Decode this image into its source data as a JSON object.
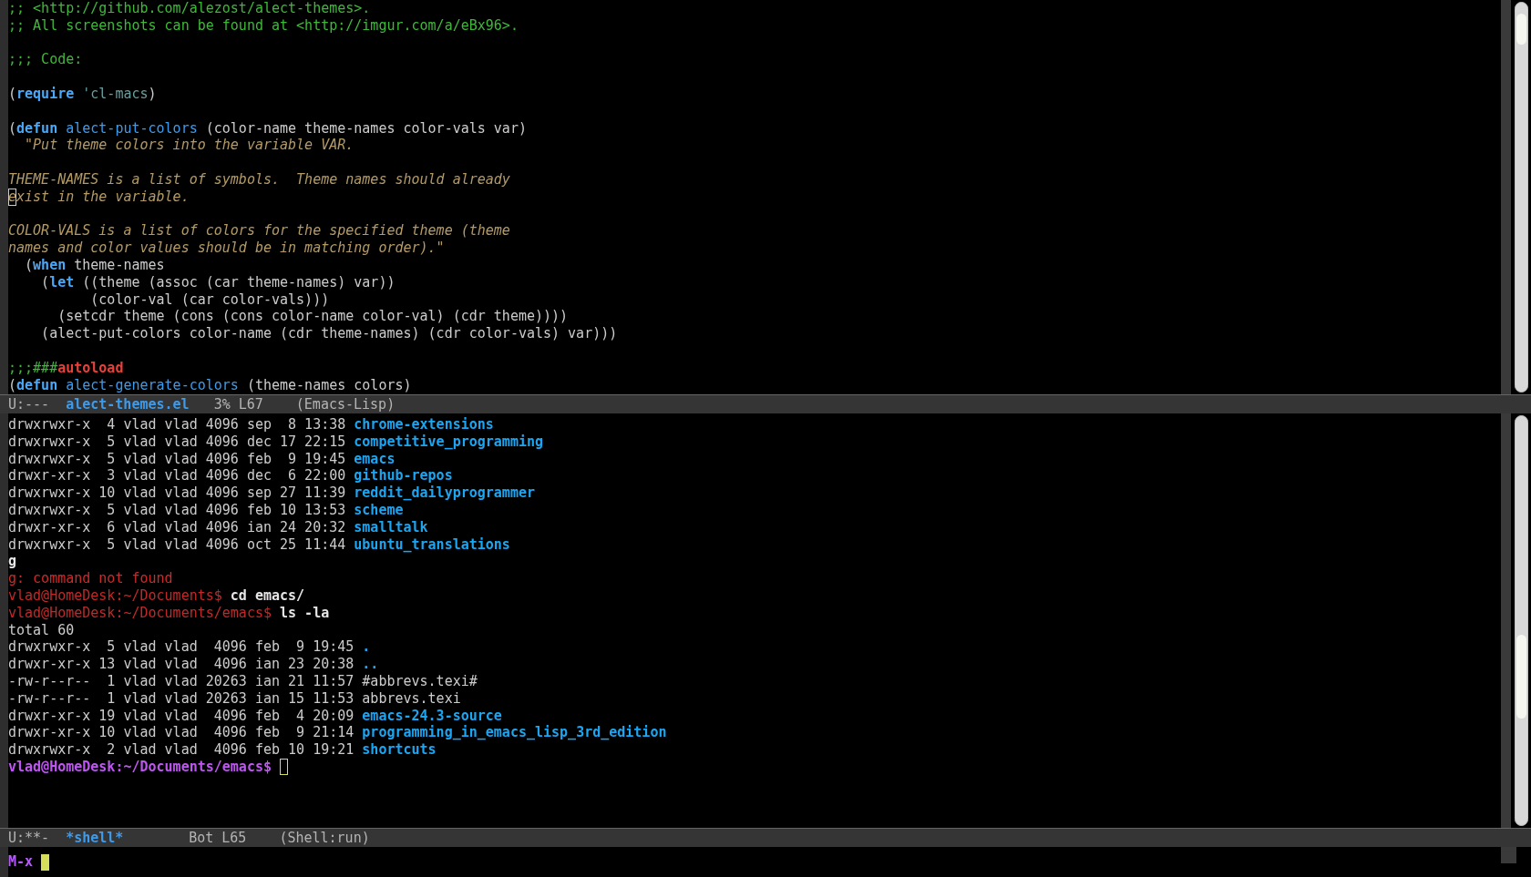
{
  "code_window": {
    "lines": [
      {
        "segments": [
          {
            "kind": "comment",
            "text": ";; <http://github.com/alezost/alect-themes>."
          }
        ]
      },
      {
        "segments": [
          {
            "kind": "comment",
            "text": ";; All screenshots can be found at <http://imgur.com/a/eBx96>."
          }
        ]
      },
      {
        "kind": "blank"
      },
      {
        "segments": [
          {
            "kind": "comment",
            "text": ";;; Code:"
          }
        ]
      },
      {
        "kind": "blank"
      },
      {
        "segments": [
          {
            "kind": "plain",
            "text": "("
          },
          {
            "kind": "keyword",
            "text": "require "
          },
          {
            "kind": "constant",
            "text": "'cl-macs"
          },
          {
            "kind": "plain",
            "text": ")"
          }
        ]
      },
      {
        "kind": "blank"
      },
      {
        "segments": [
          {
            "kind": "plain",
            "text": "("
          },
          {
            "kind": "keyword",
            "text": "defun "
          },
          {
            "kind": "function",
            "text": "alect-put-colors"
          },
          {
            "kind": "plain",
            "text": " (color-name theme-names color-vals var)"
          }
        ]
      },
      {
        "segments": [
          {
            "kind": "doc",
            "text": "  \"Put theme colors into the variable VAR."
          }
        ]
      },
      {
        "kind": "blank"
      },
      {
        "segments": [
          {
            "kind": "doc",
            "text": "THEME-NAMES is a list of symbols.  Theme names should already"
          }
        ]
      },
      {
        "segments": [
          {
            "kind": "cursor",
            "text": "e"
          },
          {
            "kind": "doc",
            "text": "xist in the variable."
          }
        ]
      },
      {
        "kind": "blank"
      },
      {
        "segments": [
          {
            "kind": "doc",
            "text": "COLOR-VALS is a list of colors for the specified theme (theme"
          }
        ]
      },
      {
        "segments": [
          {
            "kind": "doc",
            "text": "names and color values should be in matching order).\""
          }
        ]
      },
      {
        "segments": [
          {
            "kind": "plain",
            "text": "  ("
          },
          {
            "kind": "keyword",
            "text": "when"
          },
          {
            "kind": "plain",
            "text": " theme-names"
          }
        ]
      },
      {
        "segments": [
          {
            "kind": "plain",
            "text": "    ("
          },
          {
            "kind": "keyword",
            "text": "let"
          },
          {
            "kind": "plain",
            "text": " ((theme (assoc (car theme-names) var))"
          }
        ]
      },
      {
        "segments": [
          {
            "kind": "plain",
            "text": "          (color-val (car color-vals)))"
          }
        ]
      },
      {
        "segments": [
          {
            "kind": "plain",
            "text": "      (setcdr theme (cons (cons color-name color-val) (cdr theme))))"
          }
        ]
      },
      {
        "segments": [
          {
            "kind": "plain",
            "text": "    (alect-put-colors color-name (cdr theme-names) (cdr color-vals) var)))"
          }
        ]
      },
      {
        "kind": "blank"
      },
      {
        "segments": [
          {
            "kind": "comment",
            "text": ";;;###"
          },
          {
            "kind": "autoload",
            "text": "autoload"
          }
        ]
      },
      {
        "segments": [
          {
            "kind": "plain",
            "text": "("
          },
          {
            "kind": "keyword",
            "text": "defun "
          },
          {
            "kind": "function",
            "text": "alect-generate-colors"
          },
          {
            "kind": "plain",
            "text": " (theme-names colors)"
          }
        ]
      }
    ],
    "mode_line": {
      "state": "U:---",
      "buffer": "alect-themes.el",
      "position": "3% L67",
      "mode": "(Emacs-Lisp)"
    }
  },
  "shell_window": {
    "lines": [
      {
        "segments": [
          {
            "kind": "plain",
            "text": "drwxrwxr-x  4 vlad vlad 4096 sep  8 13:38 "
          },
          {
            "kind": "dir",
            "text": "chrome-extensions"
          }
        ]
      },
      {
        "segments": [
          {
            "kind": "plain",
            "text": "drwxrwxr-x  5 vlad vlad 4096 dec 17 22:15 "
          },
          {
            "kind": "dir",
            "text": "competitive_programming"
          }
        ]
      },
      {
        "segments": [
          {
            "kind": "plain",
            "text": "drwxrwxr-x  5 vlad vlad 4096 feb  9 19:45 "
          },
          {
            "kind": "dir",
            "text": "emacs"
          }
        ]
      },
      {
        "segments": [
          {
            "kind": "plain",
            "text": "drwxr-xr-x  3 vlad vlad 4096 dec  6 22:00 "
          },
          {
            "kind": "dir",
            "text": "github-repos"
          }
        ]
      },
      {
        "segments": [
          {
            "kind": "plain",
            "text": "drwxrwxr-x 10 vlad vlad 4096 sep 27 11:39 "
          },
          {
            "kind": "dir",
            "text": "reddit_dailyprogrammer"
          }
        ]
      },
      {
        "segments": [
          {
            "kind": "plain",
            "text": "drwxrwxr-x  5 vlad vlad 4096 feb 10 13:53 "
          },
          {
            "kind": "dir",
            "text": "scheme"
          }
        ]
      },
      {
        "segments": [
          {
            "kind": "plain",
            "text": "drwxr-xr-x  6 vlad vlad 4096 ian 24 20:32 "
          },
          {
            "kind": "dir",
            "text": "smalltalk"
          }
        ]
      },
      {
        "segments": [
          {
            "kind": "plain",
            "text": "drwxrwxr-x  5 vlad vlad 4096 oct 25 11:44 "
          },
          {
            "kind": "dir",
            "text": "ubuntu_translations"
          }
        ]
      },
      {
        "segments": [
          {
            "kind": "command",
            "text": "g"
          }
        ]
      },
      {
        "segments": [
          {
            "kind": "error",
            "text": "g: command not found"
          }
        ]
      },
      {
        "segments": [
          {
            "kind": "prompt",
            "text": "vlad@HomeDesk:~/Documents$"
          },
          {
            "kind": "command",
            "text": " cd emacs/"
          }
        ]
      },
      {
        "segments": [
          {
            "kind": "prompt",
            "text": "vlad@HomeDesk:~/Documents/emacs$"
          },
          {
            "kind": "command",
            "text": " ls -la"
          }
        ]
      },
      {
        "segments": [
          {
            "kind": "plain",
            "text": "total 60"
          }
        ]
      },
      {
        "segments": [
          {
            "kind": "plain",
            "text": "drwxrwxr-x  5 vlad vlad  4096 feb  9 19:45 "
          },
          {
            "kind": "dir",
            "text": "."
          }
        ]
      },
      {
        "segments": [
          {
            "kind": "plain",
            "text": "drwxr-xr-x 13 vlad vlad  4096 ian 23 20:38 "
          },
          {
            "kind": "dir",
            "text": ".."
          }
        ]
      },
      {
        "segments": [
          {
            "kind": "plain",
            "text": "-rw-r--r--  1 vlad vlad 20263 ian 21 11:57 #abbrevs.texi#"
          }
        ]
      },
      {
        "segments": [
          {
            "kind": "plain",
            "text": "-rw-r--r--  1 vlad vlad 20263 ian 15 11:53 abbrevs.texi"
          }
        ]
      },
      {
        "segments": [
          {
            "kind": "plain",
            "text": "drwxr-xr-x 19 vlad vlad  4096 feb  4 20:09 "
          },
          {
            "kind": "dir",
            "text": "emacs-24.3-source"
          }
        ]
      },
      {
        "segments": [
          {
            "kind": "plain",
            "text": "drwxr-xr-x 10 vlad vlad  4096 feb  9 21:14 "
          },
          {
            "kind": "dir",
            "text": "programming_in_emacs_lisp_3rd_edition"
          }
        ]
      },
      {
        "segments": [
          {
            "kind": "plain",
            "text": "drwxrwxr-x  2 vlad vlad  4096 feb 10 19:21 "
          },
          {
            "kind": "dir",
            "text": "shortcuts"
          }
        ]
      },
      {
        "segments": [
          {
            "kind": "prompt_active",
            "text": "vlad@HomeDesk:~/Documents/emacs$"
          }
        ],
        "cursor": true
      }
    ],
    "mode_line": {
      "state": "U:**-",
      "buffer": "*shell*",
      "position": "Bot L65",
      "mode": "(Shell:run)"
    }
  },
  "minibuffer": {
    "prompt": "M-x",
    "cursor": true
  }
}
